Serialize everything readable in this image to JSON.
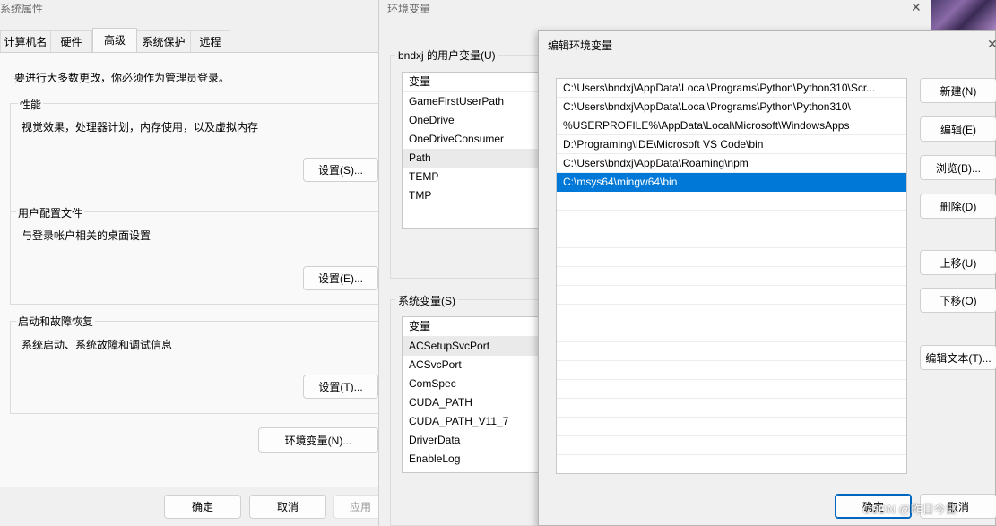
{
  "sysprops": {
    "title": "系统属性",
    "tabs": [
      {
        "label": "计算机名"
      },
      {
        "label": "硬件"
      },
      {
        "label": "高级"
      },
      {
        "label": "系统保护"
      },
      {
        "label": "远程"
      }
    ],
    "admin_note": "要进行大多数更改，你必须作为管理员登录。",
    "perf_label": "性能",
    "perf_desc": "视觉效果，处理器计划，内存使用，以及虚拟内存",
    "perf_btn": "设置(S)...",
    "profile_label": "用户配置文件",
    "profile_desc": "与登录帐户相关的桌面设置",
    "profile_btn": "设置(E)...",
    "startup_label": "启动和故障恢复",
    "startup_desc": "系统启动、系统故障和调试信息",
    "startup_btn": "设置(T)...",
    "envvar_btn": "环境变量(N)...",
    "ok": "确定",
    "cancel": "取消",
    "apply": "应用"
  },
  "envwin": {
    "title": "环境变量",
    "user_label": "bndxj 的用户变量(U)",
    "user_header": "变量",
    "user_vars": [
      "GameFirstUserPath",
      "OneDrive",
      "OneDriveConsumer",
      "Path",
      "TEMP",
      "TMP"
    ],
    "sys_label": "系统变量(S)",
    "sys_header": "变量",
    "sys_vars": [
      "ACSetupSvcPort",
      "ACSvcPort",
      "ComSpec",
      "CUDA_PATH",
      "CUDA_PATH_V11_7",
      "DriverData",
      "EnableLog"
    ]
  },
  "editwin": {
    "title": "编辑环境变量",
    "paths": [
      "C:\\Users\\bndxj\\AppData\\Local\\Programs\\Python\\Python310\\Scr...",
      "C:\\Users\\bndxj\\AppData\\Local\\Programs\\Python\\Python310\\",
      "%USERPROFILE%\\AppData\\Local\\Microsoft\\WindowsApps",
      "D:\\Programing\\IDE\\Microsoft VS Code\\bin",
      "C:\\Users\\bndxj\\AppData\\Roaming\\npm",
      "C:\\msys64\\mingw64\\bin"
    ],
    "selected_index": 5,
    "buttons": {
      "new": "新建(N)",
      "edit": "编辑(E)",
      "browse": "浏览(B)...",
      "delete": "删除(D)",
      "up": "上移(U)",
      "down": "下移(O)",
      "edit_text": "编辑文本(T)..."
    },
    "ok": "确定",
    "cancel": "取消"
  },
  "watermark": "CSDN @昨日今日",
  "colors": {
    "selection": "#0078d7",
    "accent": "#0067c0"
  }
}
